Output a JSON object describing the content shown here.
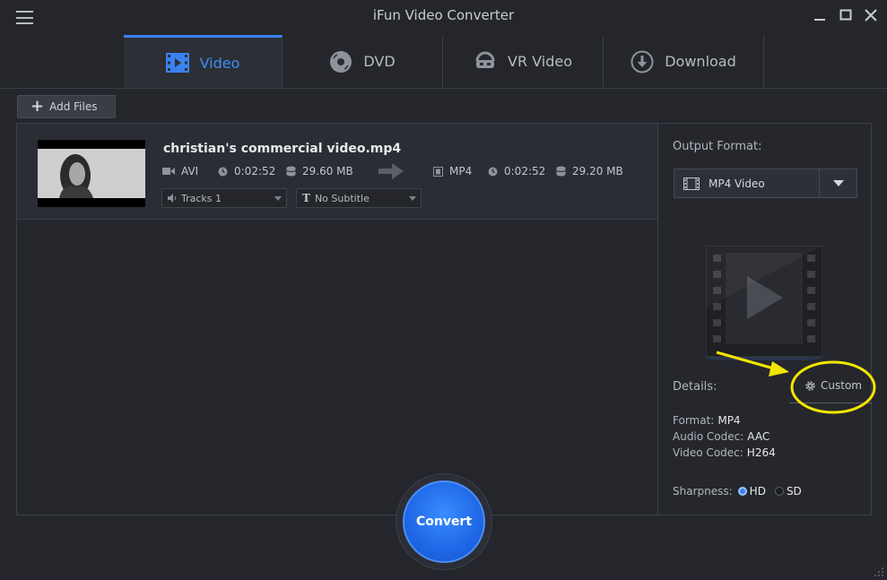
{
  "window": {
    "title": "iFun Video Converter"
  },
  "tabs": [
    {
      "label": "Video",
      "icon": "film-icon",
      "active": true
    },
    {
      "label": "DVD",
      "icon": "disc-icon",
      "active": false
    },
    {
      "label": "VR Video",
      "icon": "vr-headset-icon",
      "active": false
    },
    {
      "label": "Download",
      "icon": "download-icon",
      "active": false
    }
  ],
  "toolbar": {
    "add_files_label": "Add Files"
  },
  "file": {
    "name": "christian's commercial video.mp4",
    "source": {
      "format": "AVI",
      "duration": "0:02:52",
      "size": "29.60 MB"
    },
    "target": {
      "format": "MP4",
      "duration": "0:02:52",
      "size": "29.20 MB"
    },
    "audio_track": "Tracks 1",
    "subtitle": "No Subtitle"
  },
  "side": {
    "output_format_label": "Output Format:",
    "output_format_value": "MP4 Video",
    "details_label": "Details:",
    "custom_label": "Custom",
    "format_label": "Format:",
    "format_value": "MP4",
    "audio_codec_label": "Audio Codec:",
    "audio_codec_value": "AAC",
    "video_codec_label": "Video Codec:",
    "video_codec_value": "H264",
    "sharpness_label": "Sharpness:",
    "sharpness_hd": "HD",
    "sharpness_sd": "SD",
    "sharpness_selected": "HD"
  },
  "convert_label": "Convert",
  "colors": {
    "accent": "#3b82f0",
    "annotation": "#f2e600",
    "background": "#24262c"
  }
}
